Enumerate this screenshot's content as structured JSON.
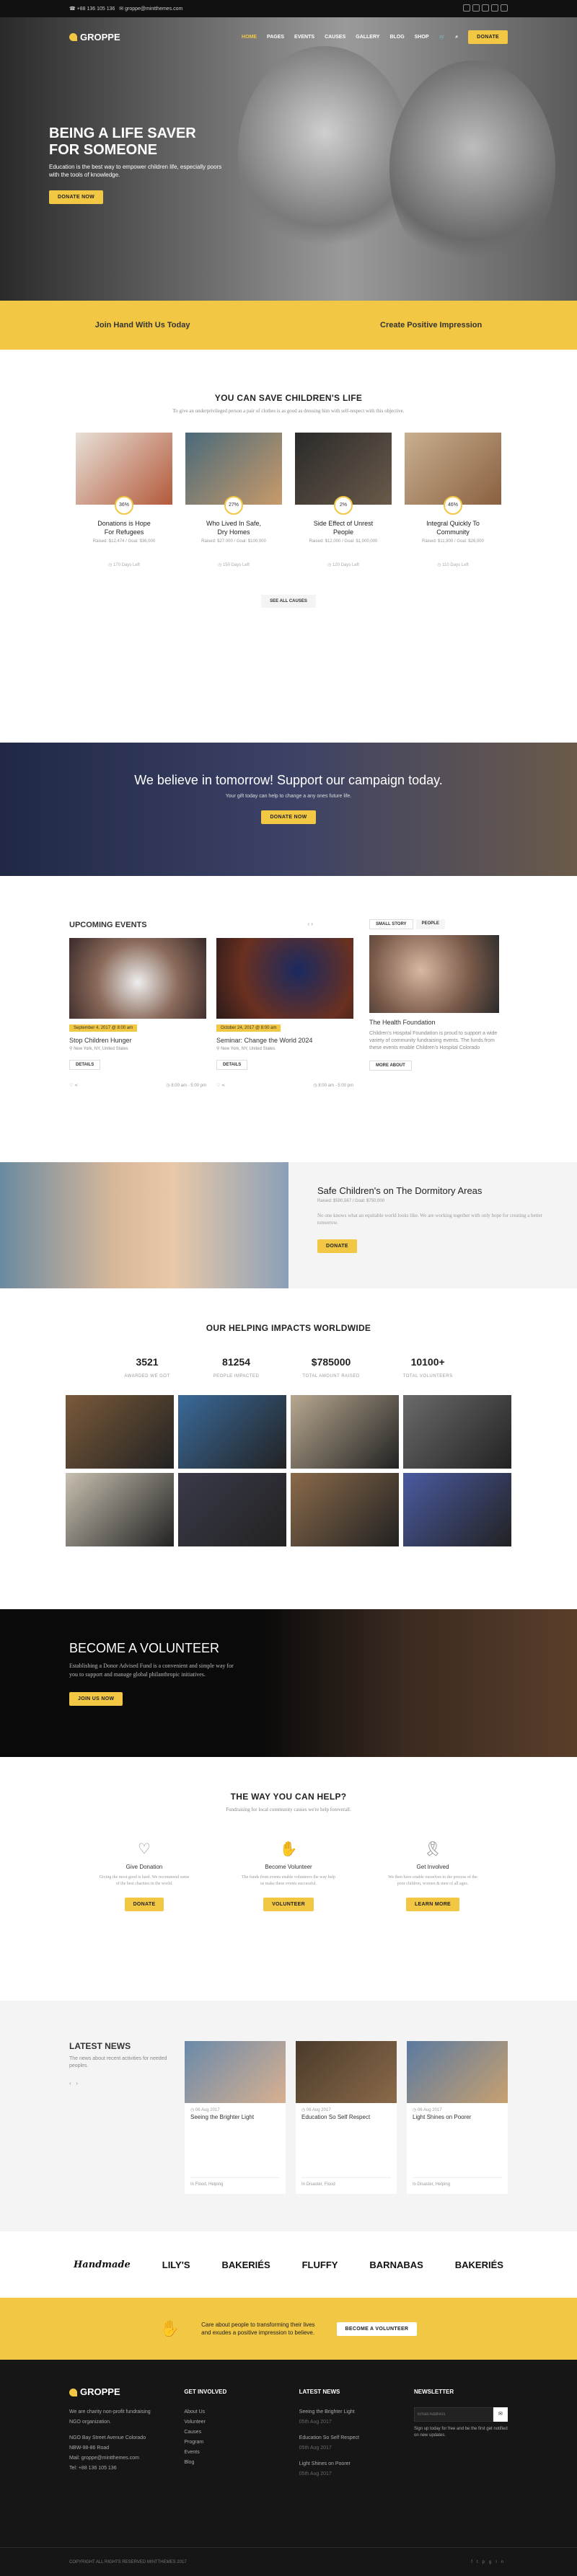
{
  "topbar": {
    "phone": "+88 136 105 136",
    "email": "groppe@mintthemes.com"
  },
  "nav": {
    "logo": "GROPPE",
    "items": [
      "HOME",
      "PAGES",
      "EVENTS",
      "CAUSES",
      "GALLERY",
      "BLOG",
      "SHOP"
    ],
    "donate": "DONATE"
  },
  "hero": {
    "title_1": "BEING A LIFE SAVER",
    "title_2": "FOR SOMEONE",
    "text": "Education is the best way to empower children life, especially poors with the tools of knowledge.",
    "button": "DONATE NOW"
  },
  "band": {
    "left": "Join Hand With Us Today",
    "right": "Create Positive Impression"
  },
  "causes": {
    "title": "YOU CAN SAVE CHILDREN'S LIFE",
    "subtitle": "To give an underprivileged person a pair of clothes is as good as dressing him with self-respect with this objective.",
    "items": [
      {
        "pct": "36%",
        "title_1": "Donations is Hope",
        "title_2": "For Refugees",
        "raised": "Raised: $12,474 / Goal: $36,000",
        "days": "170 Days Left",
        "colors": [
          "#e8e0d8",
          "#b35a3a"
        ]
      },
      {
        "pct": "27%",
        "title_1": "Who Lived In Safe,",
        "title_2": "Dry Homes",
        "raised": "Raised: $27,000 / Goal: $100,000",
        "days": "150 Days Left",
        "colors": [
          "#4a6a7a",
          "#c89a6a"
        ]
      },
      {
        "pct": "2%",
        "title_1": "Side Effect of Unrest",
        "title_2": "People",
        "raised": "Raised: $12,000 / Goal: $1,000,000",
        "days": "120 Days Left",
        "colors": [
          "#2a2a2a",
          "#6a5a4a"
        ]
      },
      {
        "pct": "46%",
        "title_1": "Integral Quickly To",
        "title_2": "Community",
        "raised": "Raised: $11,800 / Goal: $26,000",
        "days": "110 Days Left",
        "colors": [
          "#c8b090",
          "#8a6040"
        ]
      }
    ],
    "see_all": "SEE ALL CAUSES"
  },
  "campaign": {
    "title": "We believe in tomorrow! Support our campaign today.",
    "text": "Your gift today can help to change a any ones future life.",
    "button": "DONATE NOW"
  },
  "events": {
    "title": "UPCOMING EVENTS",
    "tabs": [
      "SMALL STORY",
      "PEOPLE"
    ],
    "items": [
      {
        "date": "September 4, 2017 @ 8:00 am",
        "title": "Stop Children Hunger",
        "loc": "New York, NY, United States",
        "btn": "DETAILS",
        "time": "8:00 am - 5:00 pm"
      },
      {
        "date": "October 24, 2017 @ 8:00 am",
        "title": "Seminar: Change the World 2024",
        "loc": "New York, NY, United States",
        "btn": "DETAILS",
        "time": "8:00 am - 5:00 pm"
      }
    ],
    "side": {
      "title": "The Health Foundation",
      "text": "Children's Hospital Foundation is proud to support a wide variety of community fundraising events. The funds from these events enable Children's Hospital Colorado",
      "btn": "MORE ABOUT"
    }
  },
  "story": {
    "title": "Safe Children's on The Dormitory Areas",
    "raised": "Raised: $590,567 / Goal: $750,000",
    "text": "No one knows what an equitable world looks like. We are working together with only hope for creating a better tomorrow.",
    "button": "DONATE"
  },
  "impact": {
    "title": "OUR HELPING IMPACTS WORLDWIDE",
    "stats": [
      {
        "v": "3521",
        "l": "AWARDED WE GOT"
      },
      {
        "v": "81254",
        "l": "PEOPLE IMPACTED"
      },
      {
        "v": "$785000",
        "l": "TOTAL AMOUNT RAISED"
      },
      {
        "v": "10100+",
        "l": "TOTAL VOLUNTEERS"
      }
    ],
    "gallery": [
      "#7a5a3a",
      "#3a6a9a",
      "#b8a890",
      "#6a6a6a",
      "#c8c0b0",
      "#3a3a4a",
      "#8a6a4a",
      "#4a5aa0"
    ]
  },
  "volunteer": {
    "title": "BECOME A VOLUNTEER",
    "text": "Establishing a Donor Advised Fund is a convenient and simple way for you to support and manage global philanthropic initiatives.",
    "button": "JOIN US NOW"
  },
  "ways": {
    "title": "THE WAY YOU CAN HELP?",
    "subtitle": "Fundraising for local community causes we're help foreverall.",
    "items": [
      {
        "title": "Give Donation",
        "text": "Giving the most good is hard. We recommend some of the best charities in the world.",
        "btn": "DONATE"
      },
      {
        "title": "Become Volunteer",
        "text": "The funds from events enable volunteers the way help us make these events successful.",
        "btn": "VOLUNTEER"
      },
      {
        "title": "Get Involved",
        "text": "We then have enable ourselves to the process of the poor children, women & men of all ages.",
        "btn": "LEARN MORE"
      }
    ]
  },
  "news": {
    "title": "LATEST NEWS",
    "text": "The news about recent activities for needed peoples.",
    "items": [
      {
        "date": "06 Aug 2017",
        "title": "Seeing the Brighter Light",
        "foot": "In Flood, Helping",
        "colors": [
          "#6a8aaa",
          "#d8b090"
        ]
      },
      {
        "date": "06 Aug 2017",
        "title": "Education So Self Respect",
        "foot": "In Disaster, Flood",
        "colors": [
          "#4a3a2a",
          "#8a6a4a"
        ]
      },
      {
        "date": "06 Aug 2017",
        "title": "Light Shines on Poorer",
        "foot": "In Disaster, Helping",
        "colors": [
          "#5a7aa0",
          "#c8a070"
        ]
      }
    ]
  },
  "brands": [
    "Handmade",
    "LILY'S",
    "BAKERIÉS",
    "FLUFFY",
    "BARNABAS",
    "BAKERIÉS"
  ],
  "cta": {
    "text_1": "Care about people to transforming their lives",
    "text_2": "and exudes a positive impression to believe.",
    "button": "BECOME A VOLUNTEER"
  },
  "footer": {
    "logo": "GROPPE",
    "about": "We are charity non-profit fundraising NGO organization.",
    "address": "NGO Bay Street Avenue Colorado NBW-98-86 Road",
    "email": "Mail: groppe@mintthemes.com",
    "phone": "Tel: +88 136 105 136",
    "involved_title": "GET INVOLVED",
    "involved": [
      "About Us",
      "Volunteer",
      "Causes",
      "Program",
      "Events",
      "Blog"
    ],
    "news_title": "LATEST NEWS",
    "news": [
      {
        "t": "Seeing the Brighter Light",
        "d": "05th Aug 2017"
      },
      {
        "t": "Education So Self Respect",
        "d": "05th Aug 2017"
      },
      {
        "t": "Light Shines on Poorer",
        "d": "05th Aug 2017"
      }
    ],
    "news_title2": "NEWSLETTER",
    "newsletter_placeholder": "Email Address",
    "newsletter_text": "Sign up today for free and be the first get notified on new updates.",
    "copyright": "COPYRIGHT ALL RIGHTS RESERVED MINTTHEMES 2017"
  }
}
